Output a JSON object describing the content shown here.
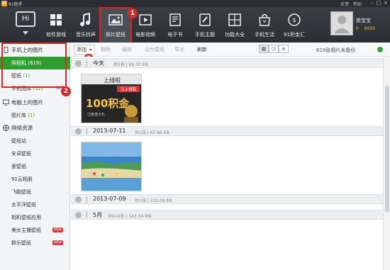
{
  "titlebar": {
    "app_title": "91助手",
    "logo_text": "91",
    "links": [
      "反馈",
      "帮助"
    ]
  },
  "toolbar": {
    "hi_label": "Hi",
    "nav": [
      {
        "label": "软件游戏",
        "icon": "grid-icon"
      },
      {
        "label": "音乐铃声",
        "icon": "music-note-icon"
      },
      {
        "label": "照片壁纸",
        "icon": "photo-icon",
        "active": true
      },
      {
        "label": "电影视频",
        "icon": "video-play-icon"
      },
      {
        "label": "电子书",
        "icon": "ebook-icon"
      },
      {
        "label": "手机主题",
        "icon": "brush-icon"
      },
      {
        "label": "功能大全",
        "icon": "gear-grid-icon"
      },
      {
        "label": "手机生活",
        "icon": "shopping-bag-icon"
      },
      {
        "label": "91积金汇",
        "icon": "coin-icon"
      }
    ],
    "user": {
      "name": "奕宝宝",
      "coins": "0",
      "points": "6595"
    }
  },
  "callouts": [
    "1",
    "2",
    "3"
  ],
  "sidebar": {
    "phone_section": "手机上的图片",
    "phone_items": [
      {
        "label": "照相机",
        "count": "(619)",
        "selected": true
      },
      {
        "label": "壁纸",
        "count": "(1)"
      },
      {
        "label": "手机图库",
        "count": "(32)",
        "extra": "展开"
      }
    ],
    "pc_section": "电脑上的图片",
    "pc_items": [
      {
        "label": "图片库",
        "count": "(1)"
      }
    ],
    "net_section": "网络资源",
    "net_items": [
      {
        "label": "壁纸站"
      },
      {
        "label": "安卓壁纸"
      },
      {
        "label": "爱壁纸"
      },
      {
        "label": "91云相册"
      },
      {
        "label": "飞鹏壁纸"
      },
      {
        "label": "太平洋壁纸"
      },
      {
        "label": "相机壁纸应用"
      },
      {
        "label": "美女主播壁纸",
        "badge": "NEW"
      },
      {
        "label": "群乐壁纸",
        "badge": "NEW"
      }
    ]
  },
  "actions": {
    "add": "添加",
    "delete": "删除",
    "edit": "编辑",
    "set_wallpaper": "设为壁纸",
    "export": "导出",
    "refresh": "刷新",
    "backup_info": "619张相片未备份"
  },
  "groups": [
    {
      "date": "今天",
      "info": "共1张 | 96.37 KB"
    },
    {
      "date": "2013-07-11",
      "info": "共1张 | 67.86 KB"
    },
    {
      "date": "2013-07-09",
      "info": "共1张 | 231.06 KB"
    },
    {
      "date": "5月",
      "info": "共614张 | 143.04 MB"
    }
  ],
  "poster": {
    "line1": "上线啦",
    "line2": "马上领取",
    "line3": "100积金",
    "line4": "注册送大礼"
  },
  "colors": {
    "toolbar_bg": "#2b2e33",
    "selected_green": "#2e9e2e",
    "callout_red": "#e52222"
  }
}
